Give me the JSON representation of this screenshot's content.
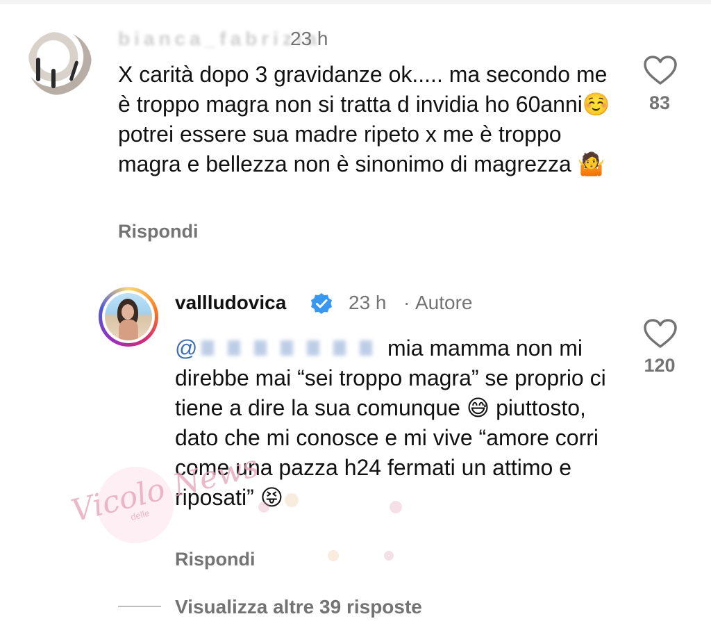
{
  "comment1": {
    "username": "bianca_fabrizia",
    "time": "23 h",
    "text": "X carità dopo 3 gravidanze ok..... ma secondo me è troppo magra non si tratta d invidia ho 60anni☺️ potrei essere sua madre ripeto x me è troppo magra e bellezza non è sinonimo di magrezza 🤷",
    "reply_label": "Rispondi",
    "like_count": "83",
    "like_icon": "heart-outline-icon"
  },
  "comment2": {
    "username": "vallludovica",
    "verified_icon": "verified-badge-icon",
    "time": "23 h",
    "separator": "·",
    "author_label": "Autore",
    "mention": "@",
    "text": "mia mamma non mi direbbe mai “sei troppo magra” se proprio ci tiene a dire la sua comunque 😅 piuttosto, dato che mi conosce e mi vive “amore corri come una pazza h24 fermati un attimo e riposati” 😝",
    "reply_label": "Rispondi",
    "like_count": "120",
    "like_icon": "heart-outline-icon"
  },
  "view_more_replies": "Visualizza altre 39 risposte",
  "watermark": {
    "main": "Vicolo News",
    "small": "delle"
  },
  "colors": {
    "text": "#111111",
    "secondary": "#737373",
    "mention": "#3d6fb6",
    "verified": "#3897f0"
  }
}
